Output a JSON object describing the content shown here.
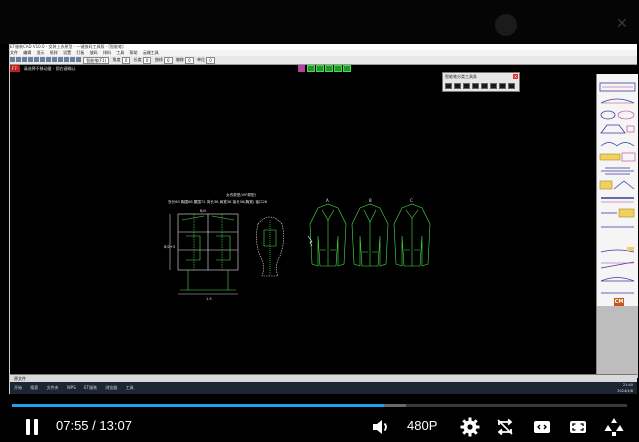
{
  "app": {
    "title": "ET服装CAD V10.0 - 女装上衣原型 - 一键放码工具版 - [智能笔]",
    "menu": [
      "文件",
      "编辑",
      "显示",
      "纸样",
      "设置",
      "打板",
      "放码",
      "排料",
      "工具",
      "帮助",
      "云端工具"
    ],
    "toolbar": {
      "pen_select": "智能笔(F1)",
      "field_1_label": "角度",
      "field_1_value": "0",
      "field_2_label": "长度",
      "field_2_value": "0",
      "field_3_label": "曲线",
      "field_3_value": "0",
      "field_4_label": "偏移",
      "field_4_value": "0",
      "field_5_label": "单位",
      "field_5_value": "0"
    },
    "status": {
      "badge": "F7-",
      "text": "请选择不移动量 - 即右键确认"
    },
    "palette": {
      "title": "智能笔分类工具条",
      "close": "×"
    },
    "drawing": {
      "title": "女衣原型(VIP原型)",
      "specs": "衣长60  胸围88  腰围72  背长38  肩宽38  袖长56(胸宽)  袖口26",
      "labels": [
        "A",
        "B",
        "C"
      ],
      "dim_1": "B/2+5",
      "dim_2": "B/4",
      "dim_3": "1.5"
    },
    "pieces_badge": "CM",
    "bottom_tab": "原文件",
    "taskbar": {
      "items": [
        "开始",
        "搜索",
        "文件夹",
        "WPS",
        "ET服装",
        "浏览器",
        "工具"
      ],
      "clock_time": "21:40",
      "clock_date": "2024/4/8"
    }
  },
  "player": {
    "current_time": "07:55",
    "separator": "/",
    "total_time": "13:07",
    "quality": "480P",
    "progress": 0.605,
    "buffered": 0.64
  },
  "icons": {
    "play_pause": "pause-icon",
    "volume": "volume-icon",
    "settings": "gear-icon",
    "loop": "loop-icon",
    "widescreen": "widescreen-icon",
    "fullscreen": "fullscreen-icon",
    "tip": "tip-icon"
  },
  "colors": {
    "progress": "#20a0f0",
    "cad_green": "#4be04b",
    "status_red": "#c21d1d"
  }
}
